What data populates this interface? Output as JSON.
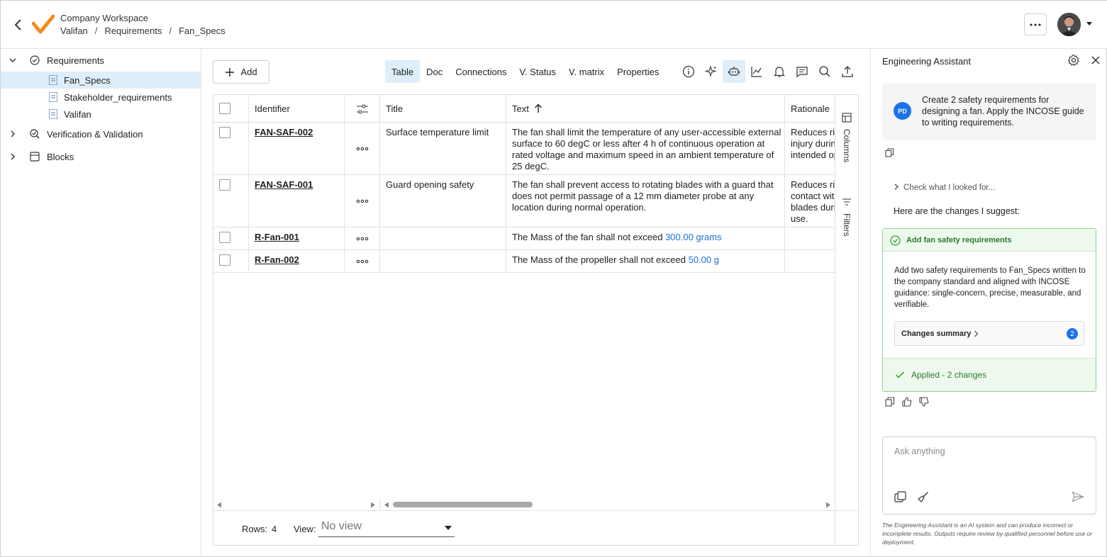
{
  "header": {
    "workspace": "Company Workspace",
    "breadcrumb": [
      "Valifan",
      "Requirements",
      "Fan_Specs"
    ],
    "separator": "/"
  },
  "sidebar": {
    "items": [
      {
        "label": "Requirements",
        "icon": "requirements-icon",
        "expanded": true
      },
      {
        "label": "Fan_Specs",
        "icon": "document-icon",
        "selected": true
      },
      {
        "label": "Stakeholder_requirements",
        "icon": "document-icon"
      },
      {
        "label": "Valifan",
        "icon": "document-icon"
      },
      {
        "label": "Verification & Validation",
        "icon": "verification-icon",
        "expanded": false
      },
      {
        "label": "Blocks",
        "icon": "blocks-icon",
        "expanded": false
      }
    ]
  },
  "toolbar": {
    "add_label": "Add",
    "tabs": [
      "Table",
      "Doc",
      "Connections",
      "V. Status",
      "V. matrix",
      "Properties"
    ],
    "active_tab": "Table",
    "icons": [
      "info-icon",
      "sparkle-icon",
      "robot-icon",
      "chart-icon",
      "bell-icon",
      "comments-icon",
      "search-icon",
      "export-icon"
    ]
  },
  "table": {
    "columns": {
      "identifier": "Identifier",
      "title": "Title",
      "text": "Text",
      "rationale": "Rationale"
    },
    "rows": [
      {
        "id": "FAN-SAF-002",
        "title": "Surface temperature limit",
        "text": [
          "The fan shall limit the temperature of any user-accessible external",
          "surface to 60 degC or less after 4 h of continuous operation at",
          "rated voltage and maximum speed in an ambient temperature of",
          "25 degC."
        ],
        "rationale": [
          "Reduces ris",
          "injury durin",
          "intended op"
        ]
      },
      {
        "id": "FAN-SAF-001",
        "title": "Guard opening safety",
        "text": [
          "The fan shall prevent access to rotating blades with a guard that",
          "does not permit passage of a 12 mm diameter probe at any",
          "location during normal operation."
        ],
        "rationale": [
          "Reduces ris",
          "contact wit",
          "blades duri",
          "use."
        ]
      },
      {
        "id": "R-Fan-001",
        "title": "",
        "text_prefix": "The Mass of the fan shall not exceed ",
        "value": "300.00",
        "unit": "grams"
      },
      {
        "id": "R-Fan-002",
        "title": "",
        "text_prefix": "The Mass of the propeller shall not exceed ",
        "value": "50.00",
        "unit": "g"
      }
    ],
    "side_tabs": [
      "Columns",
      "Filters"
    ]
  },
  "footer": {
    "rows_label": "Rows:",
    "rows_count": "4",
    "view_label": "View:",
    "view_value": "No view"
  },
  "assistant": {
    "title": "Engineering Assistant",
    "user_initials": "PD",
    "user_message": "Create 2 safety requirements for designing a fan. Apply the INCOSE guide to writing requirements.",
    "check_label": "Check what I looked for...",
    "suggest_label": "Here are the changes I suggest:",
    "card_title": "Add fan safety requirements",
    "card_body": "Add two safety requirements to Fan_Specs written to the company standard and aligned with INCOSE guidance: single-concern, precise, measurable, and verifiable.",
    "summary_label": "Changes summary",
    "summary_count": "2",
    "applied_label": "Applied - 2 changes",
    "input_placeholder": "Ask anything",
    "disclaimer": "The Engineering Assistant is an AI system and can produce incorrect or incomplete results. Outputs require review by qualified personnel before use or deployment."
  },
  "colors": {
    "selected_bg": "#deeefa",
    "accent_blue": "#1a73e8",
    "success_green": "#2a7a2a",
    "logo_orange": "#f28c1e"
  }
}
